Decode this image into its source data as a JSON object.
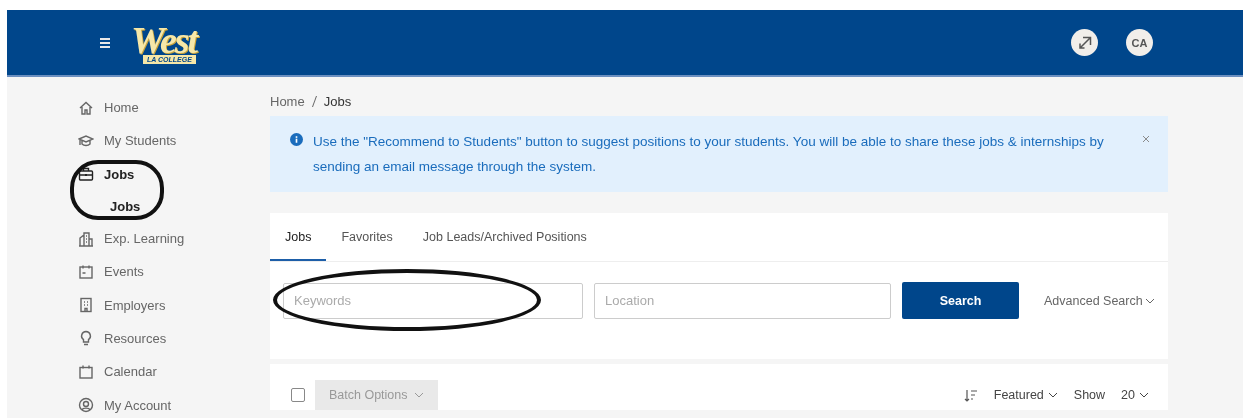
{
  "header": {
    "logo": {
      "title": "West",
      "subtitle": "LA COLLEGE"
    },
    "user_initials": "CA"
  },
  "sidebar": {
    "items": [
      {
        "label": "Home",
        "kind": "home",
        "selected": false,
        "circled": false
      },
      {
        "label": "My Students",
        "kind": "cap",
        "selected": false,
        "circled": false
      },
      {
        "label": "Jobs",
        "kind": "briefcase",
        "selected": true,
        "circled": true,
        "children": [
          {
            "label": "Jobs",
            "selected": true
          }
        ]
      },
      {
        "label": "Exp. Learning",
        "kind": "building",
        "selected": false,
        "circled": false
      },
      {
        "label": "Events",
        "kind": "calendar",
        "selected": false,
        "circled": false
      },
      {
        "label": "Employers",
        "kind": "office",
        "selected": false,
        "circled": false
      },
      {
        "label": "Resources",
        "kind": "bulb",
        "selected": false,
        "circled": false
      },
      {
        "label": "Calendar",
        "kind": "calendar2",
        "selected": false,
        "circled": false
      },
      {
        "label": "My Account",
        "kind": "account",
        "selected": false,
        "circled": false
      }
    ]
  },
  "breadcrumb": [
    "Home",
    "Jobs"
  ],
  "alert": {
    "text": "Use the \"Recommend to Students\" button to suggest positions to your students. You will be able to share these jobs & internships by sending an email message through the system."
  },
  "tabs": [
    {
      "label": "Jobs",
      "selected": true
    },
    {
      "label": "Favorites",
      "selected": false
    },
    {
      "label": "Job Leads/Archived Positions",
      "selected": false
    }
  ],
  "search": {
    "keywords": {
      "placeholder": "Keywords",
      "circled": true
    },
    "location": {
      "placeholder": "Location",
      "circled": false
    },
    "button": "Search",
    "advanced": "Advanced Search"
  },
  "toolbar": {
    "select_all": {
      "checked": false
    },
    "batch_options": {
      "label": "Batch Options",
      "disabled": true
    },
    "sort": "Featured",
    "show_label": "Show",
    "page_size": "20"
  }
}
